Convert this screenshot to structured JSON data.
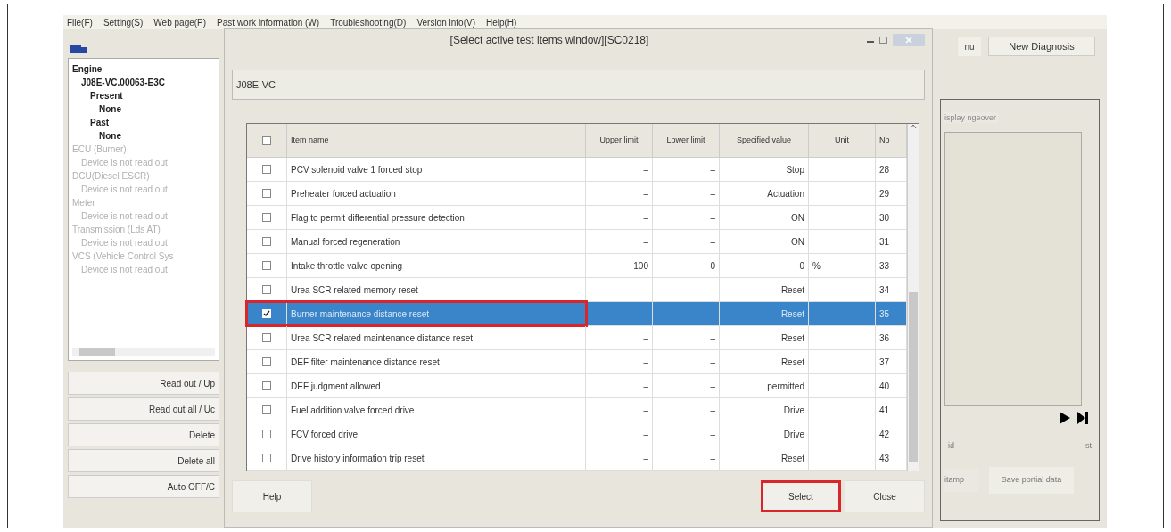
{
  "menu": [
    "File(F)",
    "Setting(S)",
    "Web page(P)",
    "Past work information (W)",
    "Troubleshooting(D)",
    "Version info(V)",
    "Help(H)"
  ],
  "tree": [
    {
      "label": "Engine",
      "disabled": false,
      "children": [
        {
          "label": "J08E-VC.00063-E3C",
          "disabled": false,
          "children": [
            {
              "label": "Present",
              "disabled": false,
              "children": [
                {
                  "label": "None",
                  "disabled": false
                }
              ]
            },
            {
              "label": "Past",
              "disabled": false,
              "children": [
                {
                  "label": "None",
                  "disabled": false
                }
              ]
            }
          ]
        }
      ]
    },
    {
      "label": "ECU (Burner)",
      "disabled": true,
      "children": [
        {
          "label": "Device is not read out",
          "disabled": true
        }
      ]
    },
    {
      "label": "DCU(Diesel ESCR)",
      "disabled": true,
      "children": [
        {
          "label": "Device is not read out",
          "disabled": true
        }
      ]
    },
    {
      "label": "Meter",
      "disabled": true,
      "children": [
        {
          "label": "Device is not read out",
          "disabled": true
        }
      ]
    },
    {
      "label": "Transmission (Lds AT)",
      "disabled": true,
      "children": [
        {
          "label": "Device is not read out",
          "disabled": true
        }
      ]
    },
    {
      "label": "VCS (Vehicle Control Sys",
      "disabled": true,
      "children": [
        {
          "label": "Device is not read out",
          "disabled": true
        }
      ]
    }
  ],
  "left_buttons": [
    "Read out / Up",
    "Read out all / Uc",
    "Delete",
    "Delete all",
    "Auto OFF/C"
  ],
  "dialog": {
    "title": "[Select active test items window][SC0218]",
    "engine_field": "J08E-VC",
    "columns": [
      "Item name",
      "Upper limit",
      "Lower limit",
      "Specified value",
      "Unit",
      "No"
    ],
    "header_checked": false,
    "rows": [
      {
        "checked": false,
        "selected": false,
        "annotated": false,
        "cells": [
          "PCV solenoid valve 1 forced stop",
          "–",
          "–",
          "Stop",
          "",
          "28"
        ]
      },
      {
        "checked": false,
        "selected": false,
        "annotated": false,
        "cells": [
          "Preheater forced actuation",
          "–",
          "–",
          "Actuation",
          "",
          "29"
        ]
      },
      {
        "checked": false,
        "selected": false,
        "annotated": false,
        "cells": [
          "Flag to permit differential pressure detection",
          "–",
          "–",
          "ON",
          "",
          "30"
        ]
      },
      {
        "checked": false,
        "selected": false,
        "annotated": false,
        "cells": [
          "Manual forced regeneration",
          "–",
          "–",
          "ON",
          "",
          "31"
        ]
      },
      {
        "checked": false,
        "selected": false,
        "annotated": false,
        "cells": [
          "Intake throttle valve opening",
          "100",
          "0",
          "0",
          "%",
          "33"
        ]
      },
      {
        "checked": false,
        "selected": false,
        "annotated": false,
        "cells": [
          "Urea SCR related memory reset",
          "–",
          "–",
          "Reset",
          "",
          "34"
        ]
      },
      {
        "checked": true,
        "selected": true,
        "annotated": true,
        "cells": [
          "Burner maintenance distance reset",
          "–",
          "–",
          "Reset",
          "",
          "35"
        ]
      },
      {
        "checked": false,
        "selected": false,
        "annotated": false,
        "cells": [
          "Urea SCR related maintenance distance reset",
          "–",
          "–",
          "Reset",
          "",
          "36"
        ]
      },
      {
        "checked": false,
        "selected": false,
        "annotated": false,
        "cells": [
          "DEF filter maintenance distance reset",
          "–",
          "–",
          "Reset",
          "",
          "37"
        ]
      },
      {
        "checked": false,
        "selected": false,
        "annotated": false,
        "cells": [
          "DEF judgment allowed",
          "–",
          "–",
          "permitted",
          "",
          "40"
        ]
      },
      {
        "checked": false,
        "selected": false,
        "annotated": false,
        "cells": [
          "Fuel addition valve forced drive",
          "–",
          "–",
          "Drive",
          "",
          "41"
        ]
      },
      {
        "checked": false,
        "selected": false,
        "annotated": false,
        "cells": [
          "FCV forced drive",
          "–",
          "–",
          "Drive",
          "",
          "42"
        ]
      },
      {
        "checked": false,
        "selected": false,
        "annotated": false,
        "cells": [
          "Drive history information trip reset",
          "–",
          "–",
          "Reset",
          "",
          "43"
        ]
      }
    ],
    "buttons": [
      {
        "label": "Help",
        "annotated": false
      },
      {
        "label": "Select",
        "annotated": true
      },
      {
        "label": "Close",
        "annotated": false
      }
    ]
  },
  "right": {
    "top_buttons": [
      "nu",
      "New Diagnosis"
    ],
    "tab": "isplay ngeover",
    "left_mark": "id",
    "right_mark": "st",
    "bottom_buttons": [
      "itamp",
      "Save portial data"
    ]
  }
}
